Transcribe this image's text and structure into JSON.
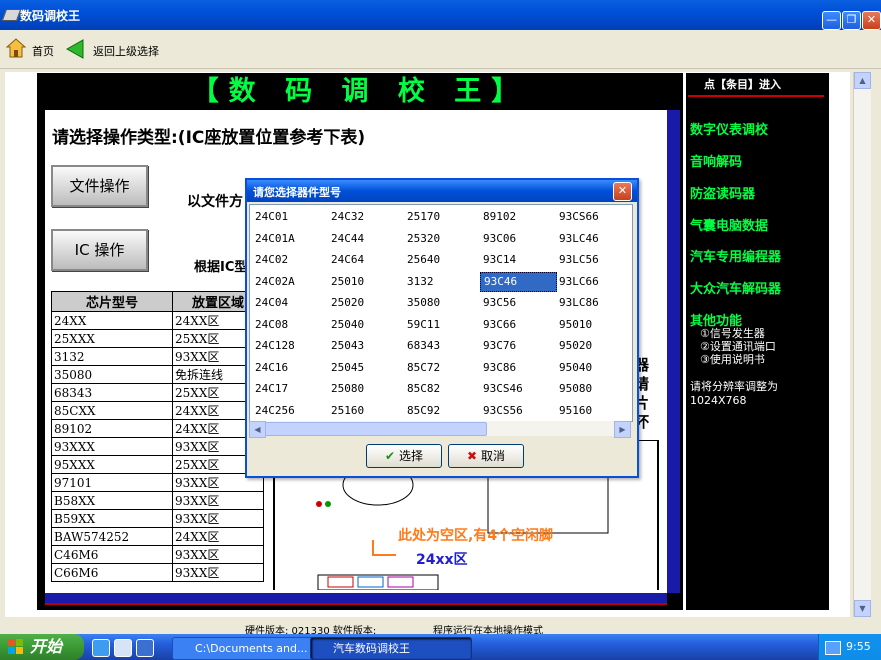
{
  "window": {
    "title": "数码调校王"
  },
  "toolbar": {
    "home_label": "首页",
    "back_label": "返回上级选择"
  },
  "app": {
    "banner": "【数 码 调 校 王】",
    "instruction": "请选择操作类型:(IC座放置位置参考下表)",
    "file_button": "文件操作",
    "ic_button": "IC 操作",
    "file_mode_text": "以文件方",
    "ic_mode_text": "根据IC型",
    "table_headers": [
      "芯片型号",
      "放置区域"
    ],
    "table_rows": [
      [
        "24XX",
        "24XX区"
      ],
      [
        "25XXX",
        "25XX区"
      ],
      [
        "3132",
        "93XX区"
      ],
      [
        "35080",
        "免拆连线"
      ],
      [
        "68343",
        "25XX区"
      ],
      [
        "85CXX",
        "24XX区"
      ],
      [
        "89102",
        "24XX区"
      ],
      [
        "93XXX",
        "93XX区"
      ],
      [
        "95XXX",
        "25XX区"
      ],
      [
        "97101",
        "93XX区"
      ],
      [
        "B58XX",
        "93XX区"
      ],
      [
        "B59XX",
        "93XX区"
      ],
      [
        "BAW574252",
        "24XX区"
      ],
      [
        "C46M6",
        "93XX区"
      ],
      [
        "C66M6",
        "93XX区"
      ]
    ],
    "diagram_note": "此处为空区,有4个空闲脚",
    "diagram_zone": "24xx区",
    "side_text": "器请片坏"
  },
  "sidebar": {
    "header": "点【条目】进入",
    "items": [
      "数字仪表调校",
      "音响解码",
      "防盗读码器",
      "气囊电脑数据",
      "汽车专用编程器",
      "大众汽车解码器",
      "其他功能"
    ],
    "sub_items": [
      "①信号发生器",
      "②设置通讯端口",
      "③使用说明书"
    ],
    "resolution_note": "请将分辨率调整为 1024X768"
  },
  "dialog": {
    "title": "请您选择器件型号",
    "columns": [
      [
        "24C01",
        "24C01A",
        "24C02",
        "24C02A",
        "24C04",
        "24C08",
        "24C128",
        "24C16",
        "24C17",
        "24C256"
      ],
      [
        "24C32",
        "24C44",
        "24C64",
        "25010",
        "25020",
        "25040",
        "25043",
        "25045",
        "25080",
        "25160"
      ],
      [
        "25170",
        "25320",
        "25640",
        "3132",
        "35080",
        "59C11",
        "68343",
        "85C72",
        "85C82",
        "85C92"
      ],
      [
        "89102",
        "93C06",
        "93C14",
        "93C46",
        "93C56",
        "93C66",
        "93C76",
        "93C86",
        "93CS46",
        "93CS56"
      ],
      [
        "93CS66",
        "93LC46",
        "93LC56",
        "93LC66",
        "93LC86",
        "95010",
        "95020",
        "95040",
        "95080",
        "95160"
      ]
    ],
    "selected": "93C46",
    "choose_label": "选择",
    "cancel_label": "取消"
  },
  "status": {
    "left": "硬件版本: 021330   软件版本:",
    "right": "程序运行在本地操作模式"
  },
  "taskbar": {
    "start": "开始",
    "tasks": [
      "C:\\Documents and...",
      "汽车数码调校王"
    ],
    "clock": "9:55"
  }
}
